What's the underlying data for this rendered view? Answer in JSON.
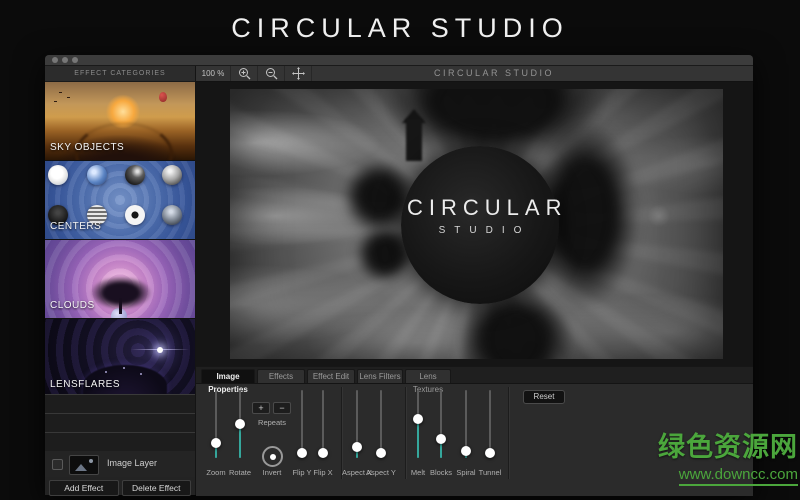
{
  "app_title": "CIRCULAR STUDIO",
  "titlebar": {
    "buttons": [
      "close",
      "minimize",
      "zoom"
    ]
  },
  "sidebar": {
    "header": "EFFECT CATEGORIES",
    "categories": [
      {
        "label": "SKY OBJECTS",
        "style": "sky"
      },
      {
        "label": "CENTERS",
        "style": "centers"
      },
      {
        "label": "CLOUDS",
        "style": "clouds"
      },
      {
        "label": "LENSFLARES",
        "style": "flares"
      }
    ],
    "centers_options": [
      "starburst",
      "earth",
      "shadow-sphere",
      "metal-sphere",
      "carbon-sphere",
      "striped-sphere",
      "dot-circle",
      "mirror-ball"
    ],
    "empty_layer_rows": 3,
    "layer": {
      "label": "Image Layer"
    },
    "buttons": {
      "add": "Add Effect",
      "delete": "Delete Effect"
    }
  },
  "toolbar": {
    "zoom_level": "100 %",
    "logo": "CIRCULAR STUDIO"
  },
  "canvas": {
    "logo_line1": "CIRCULAR",
    "logo_line2": "STUDIO"
  },
  "panel": {
    "tabs": [
      {
        "label": "Image Properties",
        "selected": true
      },
      {
        "label": "Effects",
        "selected": false
      },
      {
        "label": "Effect Edit",
        "selected": false
      },
      {
        "label": "Lens Filters",
        "selected": false
      },
      {
        "label": "Lens Textures",
        "selected": false
      }
    ],
    "repeats": {
      "label": "Repeats",
      "plus": "+",
      "minus": "−"
    },
    "invert_label": "Invert",
    "reset_label": "Reset",
    "sliders": [
      {
        "label": "Zoom",
        "value": 0.22
      },
      {
        "label": "Rotate",
        "value": 0.5
      },
      {
        "label": "Flip Y",
        "value": 0.05
      },
      {
        "label": "Flip X",
        "value": 0.05
      },
      {
        "label": "Aspect X",
        "value": 0.16
      },
      {
        "label": "Aspect Y",
        "value": 0.05
      },
      {
        "label": "Melt",
        "value": 0.57
      },
      {
        "label": "Blocks",
        "value": 0.28
      },
      {
        "label": "Spiral",
        "value": 0.1
      },
      {
        "label": "Tunnel",
        "value": 0.05
      }
    ]
  },
  "watermark": {
    "line1": "绿色资源网",
    "line2": "www.downcc.com",
    "color": "#4ba63c"
  },
  "colors": {
    "accent_teal": "#35a79c",
    "knob": "#ffffff",
    "window_bg": "#272727"
  }
}
